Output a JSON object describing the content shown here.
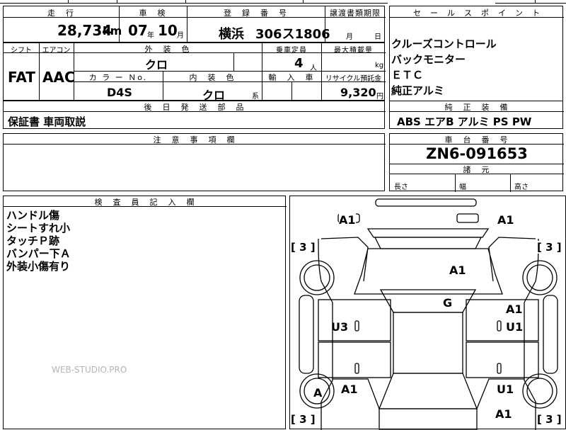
{
  "top_strip": {
    "partial": ""
  },
  "summary": {
    "mileage_label": "走　行",
    "mileage_value": "28,734",
    "mileage_unit": "km",
    "inspection_label": "車　検",
    "inspection_year": "07",
    "inspection_year_unit": "年",
    "inspection_month": "10",
    "inspection_month_unit": "月",
    "reg_label": "登　録　番　号",
    "reg_city": "横浜",
    "reg_number": "306ス1806",
    "transfer_label": "譲渡書類期限",
    "transfer_month_unit": "月",
    "transfer_day_unit": "日"
  },
  "specs": {
    "shift_label": "シフト",
    "shift_value": "FAT",
    "ac_label": "エアコン",
    "ac_value": "AAC",
    "exterior_color_label": "外　装　色",
    "exterior_color_value": "クロ",
    "capacity_label": "乗車定員",
    "capacity_value": "4",
    "capacity_unit": "人",
    "max_load_label": "最大積載量",
    "max_load_unit": "kg",
    "color_no_label": "カ ラ ー Ｎo.",
    "color_no_value": "D4S",
    "interior_color_label": "内　装　色",
    "interior_color_value": "クロ",
    "interior_color_suffix": "系",
    "import_label": "輸　入　車",
    "recycle_label": "リサイクル預託金",
    "recycle_value": "9,320",
    "recycle_unit": "円"
  },
  "later_parts": {
    "label": "後　日　発　送　部　品",
    "value": "保証書 車両取説"
  },
  "notes_section": {
    "label": "注　意　事　項　欄"
  },
  "inspector": {
    "label": "検　査　員　記　入　欄",
    "lines": [
      "ハンドル傷",
      "シートすれ小",
      "タッチＰ跡",
      "バンパー下Ａ",
      "外装小傷有り"
    ]
  },
  "sales_points": {
    "label": "セ　ー　ル　ス　ポ　イ　ン　ト",
    "items": [
      "クルーズコントロール",
      "バックモニター",
      "ＥＴＣ",
      "純正アルミ"
    ]
  },
  "equipment": {
    "label": "純　正　装　備",
    "value": "ABS エアB アルミ PS PW"
  },
  "chassis": {
    "label": "車　台　番　号",
    "value": "ZN6-091653"
  },
  "dimensions": {
    "label": "諸　元",
    "length_label": "長さ",
    "width_label": "幅",
    "height_label": "高さ"
  },
  "watermark": "WEB-STUDIO.PRO",
  "damage_map": {
    "marks": {
      "front_left": "A1",
      "front_right": "A1",
      "hood": "A1",
      "windshield": "G",
      "right_front_door": "A1",
      "right_rear_door": "U1",
      "left_front_door": "U3",
      "left_rear_wheel": "A",
      "left_rear_quarter": "A1",
      "right_rear_quarter": "U1",
      "rear_right": "A1"
    },
    "tread": {
      "front_left": "[ 3 ]",
      "front_right": "[ 3 ]",
      "rear_left": "[ 3 ]",
      "rear_right": "[ 3 ]"
    }
  }
}
